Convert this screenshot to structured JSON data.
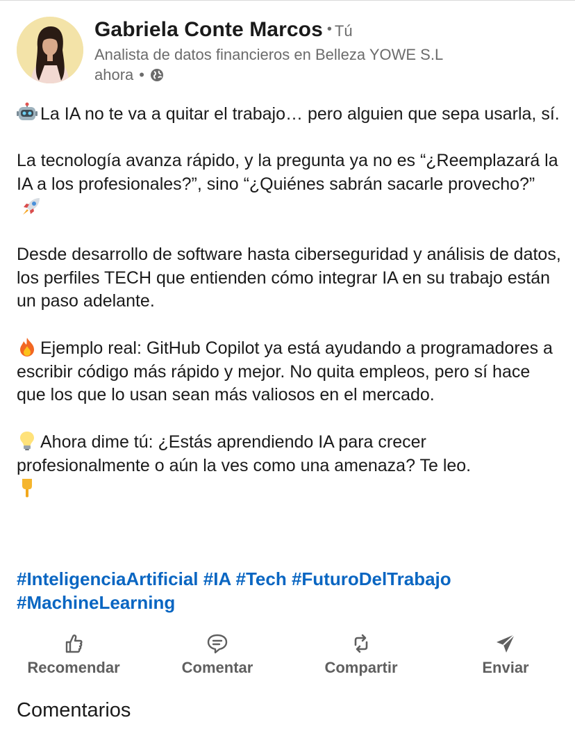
{
  "author": {
    "name": "Gabriela Conte Marcos",
    "separator": "•",
    "relation": "Tú",
    "headline": "Analista de datos financieros en Belleza YOWE S.L",
    "time": "ahora",
    "meta_separator": "•",
    "visibility_icon": "globe-icon"
  },
  "post": {
    "p1": "La IA no te va a quitar el trabajo… pero alguien que sepa usarla, sí.",
    "p2": "La tecnología avanza rápido, y la pregunta ya no es “¿Reemplazará la IA a los profesionales?”, sino “¿Quiénes sabrán sacarle provecho?”",
    "p3": "Desde desarrollo de software hasta ciberseguridad y análisis de datos, los perfiles TECH que entienden cómo integrar IA en su trabajo están un paso adelante.",
    "p4": "Ejemplo real: GitHub Copilot ya está ayudando a programadores a escribir código más rápido y mejor. No quita empleos, pero sí hace que los que lo usan sean más valiosos en el mercado.",
    "p5": "Ahora dime tú: ¿Estás aprendiendo IA para crecer profesionalmente o aún la ves como una amenaza? Te leo.",
    "emojis": [
      "robot-icon",
      "rocket-icon",
      "fire-icon",
      "lightbulb-icon",
      "pointing-down-icon"
    ]
  },
  "hashtags": [
    "#InteligenciaArtificial",
    "#IA",
    "#Tech",
    "#FuturoDelTrabajo",
    "#MachineLearning"
  ],
  "actions": {
    "like": "Recomendar",
    "comment": "Comentar",
    "share": "Compartir",
    "send": "Enviar"
  },
  "comments_title": "Comentarios",
  "colors": {
    "link": "#0a66c2",
    "secondary_text": "#6b6b6b",
    "action_text": "#5f5f5f",
    "primary_text": "#1a1a1a"
  }
}
